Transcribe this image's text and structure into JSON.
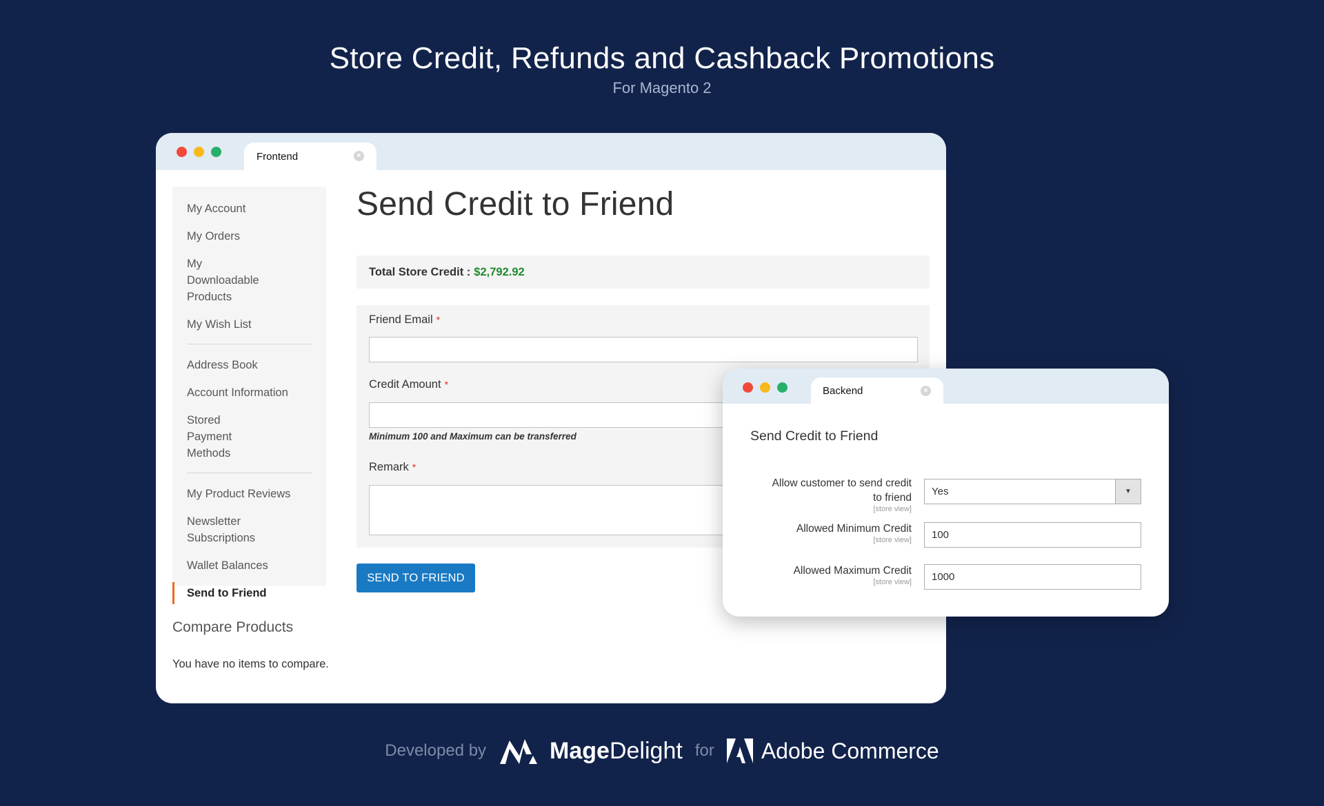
{
  "hero": {
    "title": "Store Credit, Refunds and Cashback Promotions",
    "subtitle": "For Magento 2"
  },
  "frontend": {
    "tab_label": "Frontend",
    "sidebar": {
      "items": [
        {
          "label": "My Account"
        },
        {
          "label": "My Orders"
        },
        {
          "label": "My Downloadable Products"
        },
        {
          "label": "My Wish List"
        },
        {
          "label": "Address Book"
        },
        {
          "label": "Account Information"
        },
        {
          "label": "Stored Payment Methods"
        },
        {
          "label": "My Product Reviews"
        },
        {
          "label": "Newsletter Subscriptions"
        },
        {
          "label": "Wallet Balances"
        },
        {
          "label": "Send to Friend",
          "active": true
        }
      ]
    },
    "compare": {
      "title": "Compare Products",
      "empty_text": "You have no items to compare."
    },
    "page_title": "Send Credit to Friend",
    "total_credit": {
      "label": "Total Store Credit :",
      "value": "$2,792.92"
    },
    "form": {
      "friend_email": {
        "label": "Friend Email",
        "required_mark": "*",
        "value": ""
      },
      "credit_amount": {
        "label": "Credit Amount",
        "required_mark": "*",
        "value": "",
        "note": "Minimum 100 and Maximum can be transferred"
      },
      "remark": {
        "label": "Remark",
        "required_mark": "*",
        "value": ""
      },
      "submit_label": "SEND TO FRIEND"
    }
  },
  "backend": {
    "tab_label": "Backend",
    "section_title": "Send Credit to Friend",
    "fields": [
      {
        "label_line1": "Allow customer to send credit",
        "label_line2": "to friend",
        "scope": "[store view]",
        "value": "Yes",
        "type": "select"
      },
      {
        "label": "Allowed Minimum Credit",
        "scope": "[store view]",
        "value": "100",
        "type": "text"
      },
      {
        "label": "Allowed Maximum Credit",
        "scope": "[store view]",
        "value": "1000",
        "type": "text"
      }
    ]
  },
  "footer": {
    "developed_by": "Developed by",
    "brand_bold": "Mage",
    "brand_light": "Delight",
    "for": "for",
    "platform": "Adobe Commerce"
  },
  "icons": {
    "tab_close": "×",
    "dropdown": "▼"
  },
  "colors": {
    "background": "#12234b",
    "accent_button": "#1979c3",
    "credit_value": "#1f8b2c",
    "active_marker": "#ef6922",
    "required": "#e02b27"
  }
}
